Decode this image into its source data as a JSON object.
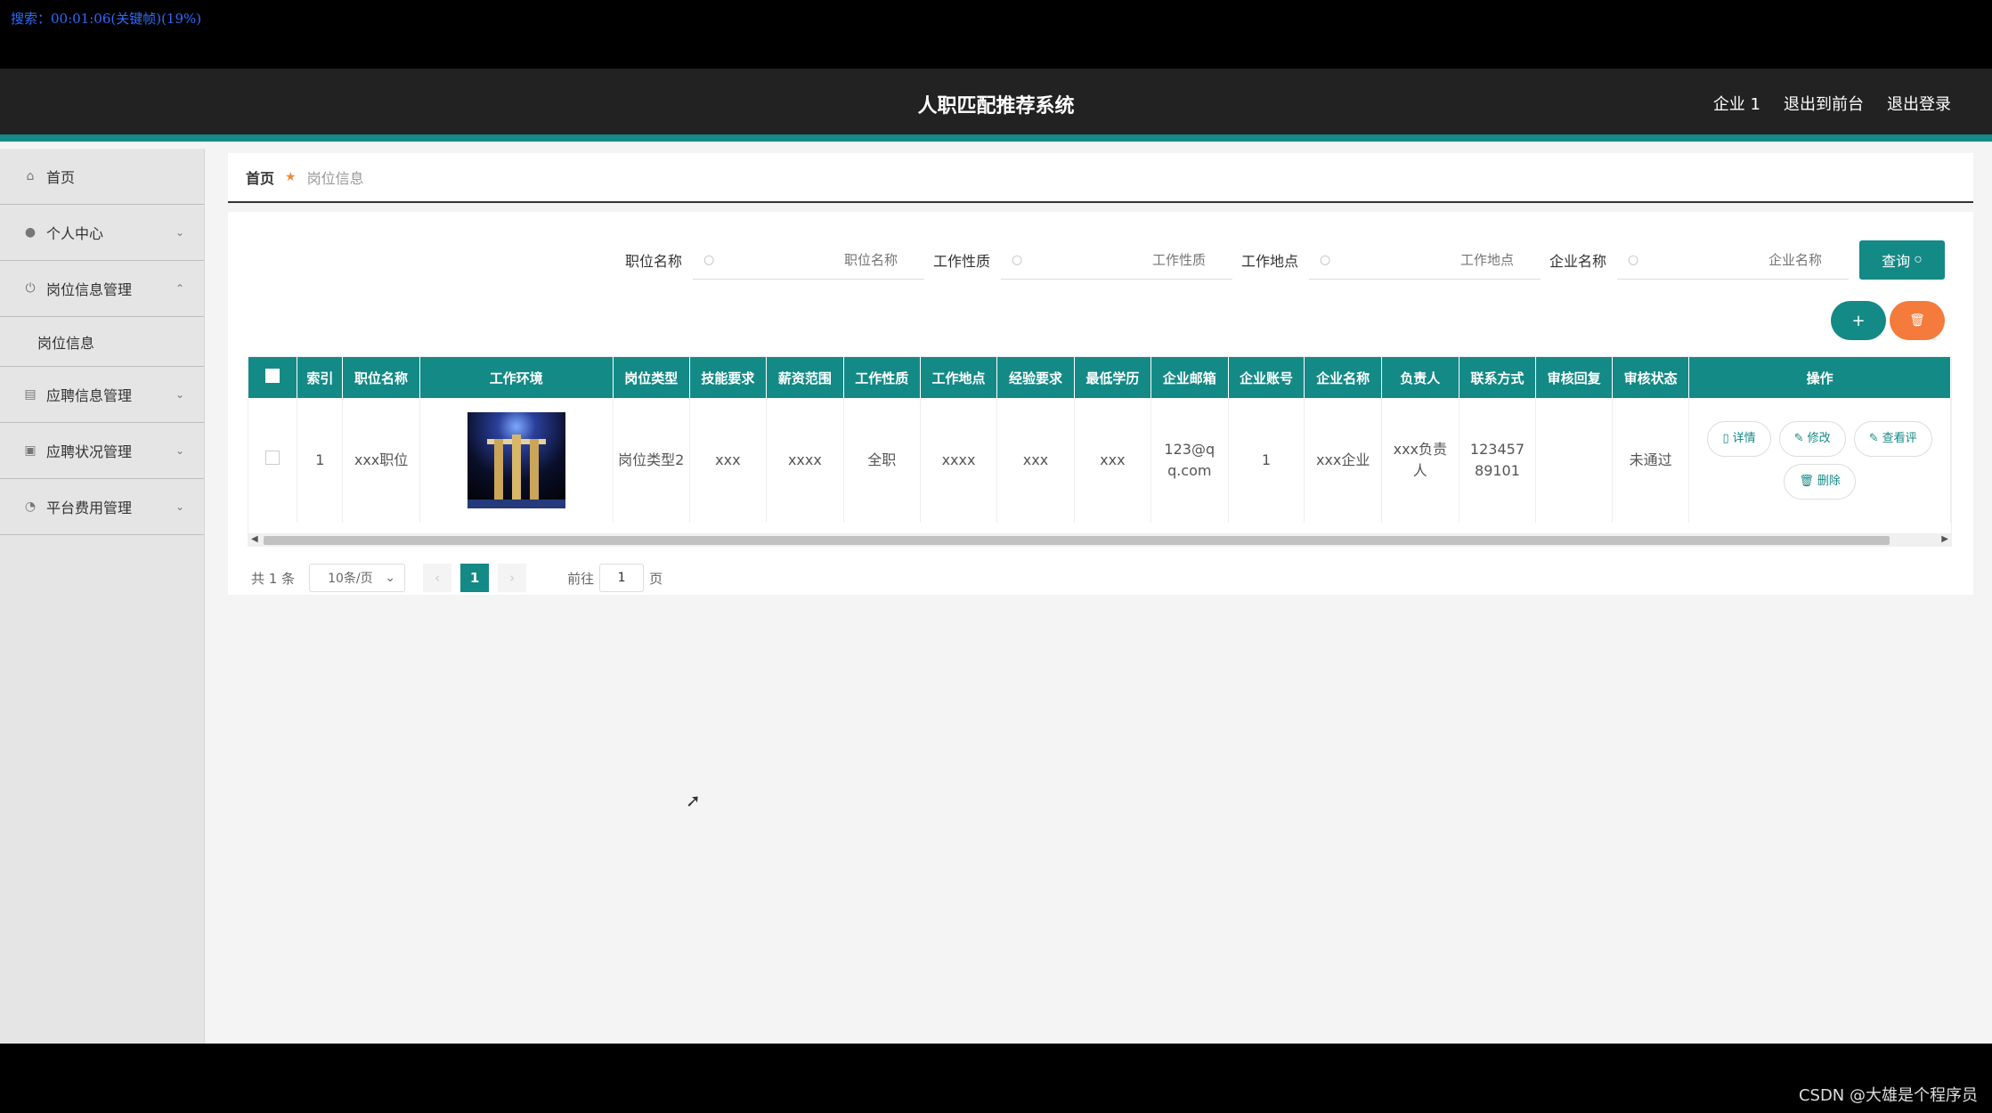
{
  "overlay": {
    "text": "搜索：00:01:06(关键帧)(19%)"
  },
  "header": {
    "title": "人职匹配推荐系统",
    "user": "企业 1",
    "to_front": "退出到前台",
    "logout": "退出登录"
  },
  "sidebar": {
    "items": [
      {
        "label": "首页",
        "icon": "home-icon",
        "chev": ""
      },
      {
        "label": "个人中心",
        "icon": "user-icon",
        "chev": "⌄"
      },
      {
        "label": "岗位信息管理",
        "icon": "power-icon",
        "chev": "⌃"
      },
      {
        "label": "岗位信息",
        "icon": "",
        "chev": ""
      },
      {
        "label": "应聘信息管理",
        "icon": "chart-icon",
        "chev": "⌄"
      },
      {
        "label": "应聘状况管理",
        "icon": "clipboard-icon",
        "chev": "⌄"
      },
      {
        "label": "平台费用管理",
        "icon": "gauge-icon",
        "chev": "⌄"
      }
    ]
  },
  "breadcrumb": {
    "home": "首页",
    "current": "岗位信息"
  },
  "search": {
    "fields": [
      {
        "label": "职位名称",
        "placeholder": "职位名称"
      },
      {
        "label": "工作性质",
        "placeholder": "工作性质"
      },
      {
        "label": "工作地点",
        "placeholder": "工作地点"
      },
      {
        "label": "企业名称",
        "placeholder": "企业名称"
      }
    ],
    "query_label": "查询"
  },
  "table": {
    "headers": [
      "索引",
      "职位名称",
      "工作环境",
      "岗位类型",
      "技能要求",
      "薪资范围",
      "工作性质",
      "工作地点",
      "经验要求",
      "最低学历",
      "企业邮箱",
      "企业账号",
      "企业名称",
      "负责人",
      "联系方式",
      "审核回复",
      "审核状态",
      "操作"
    ],
    "rows": [
      {
        "index": "1",
        "job": "xxx职位",
        "type": "岗位类型2",
        "skill": "xxx",
        "salary": "xxxx",
        "nature": "全职",
        "location": "xxxx",
        "exp": "xxx",
        "edu": "xxx",
        "email": "123@qq.com",
        "account": "1",
        "company": "xxx企业",
        "manager": "xxx负责人",
        "phone": "12345789101",
        "reply": "",
        "status": "未通过"
      }
    ],
    "ops": {
      "detail": "详情",
      "edit": "修改",
      "view": "查看评",
      "delete": "删除"
    }
  },
  "pager": {
    "total": "共 1 条",
    "size": "10条/页",
    "page": "1",
    "goto": "前往",
    "goto_value": "1",
    "page_unit": "页"
  },
  "watermark": "CSDN @大雄是个程序员"
}
